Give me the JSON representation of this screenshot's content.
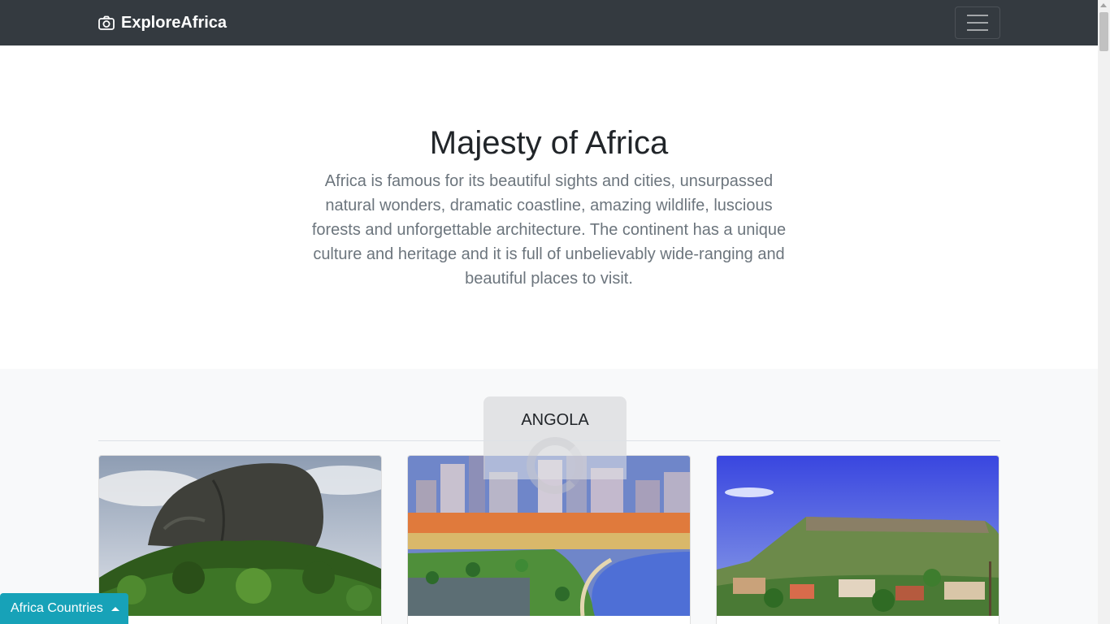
{
  "navbar": {
    "brand": "ExploreAfrica",
    "brand_icon": "camera-icon",
    "menu_icon": "hamburger-menu-icon",
    "background": "#343a40"
  },
  "hero": {
    "title": "Majesty of Africa",
    "description": "Africa is famous for its beautiful sights and cities, unsurpassed natural wonders, dramatic coastline, amazing wildlife, luscious forests and unforgettable architecture. The continent has a unique culture and heritage and it is full of unbelievably wide-ranging and beautiful places to visit."
  },
  "gallery": {
    "country": "ANGOLA",
    "cards": [
      {
        "image": "rock-formation-forest-photo"
      },
      {
        "image": "luanda-city-waterfront-photo"
      },
      {
        "image": "town-mountain-plateau-photo"
      }
    ]
  },
  "countries_button": {
    "label": "Africa Countries",
    "icon": "caret-up-icon",
    "color": "#17a2b8"
  }
}
